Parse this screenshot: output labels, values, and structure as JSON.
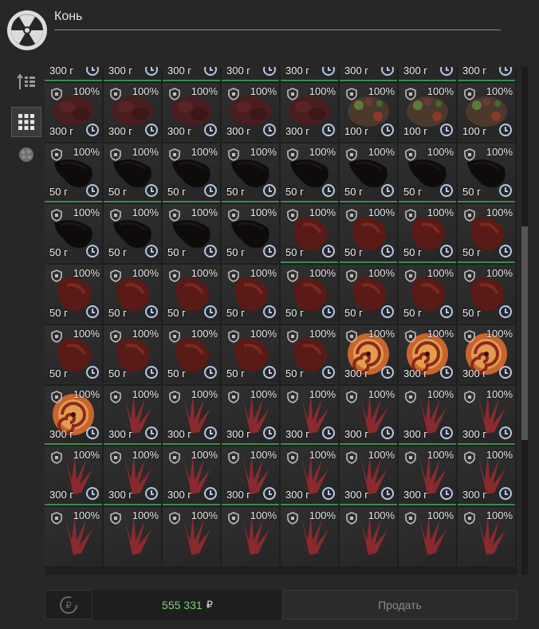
{
  "header": {
    "title": "Конь"
  },
  "sidebar": {
    "buttons": [
      {
        "name": "sort-icon"
      },
      {
        "name": "grid-view-icon",
        "active": true
      },
      {
        "name": "category-icon"
      }
    ]
  },
  "inventory": {
    "condition_icon": "shield-icon",
    "timer_icon": "clock-icon",
    "rows": [
      {
        "items": [
          {
            "pct": "",
            "wt": "300 г",
            "art": "meat",
            "green": true
          },
          {
            "pct": "",
            "wt": "300 г",
            "art": "meat",
            "green": true
          },
          {
            "pct": "",
            "wt": "300 г",
            "art": "meat",
            "green": true
          },
          {
            "pct": "",
            "wt": "300 г",
            "art": "meat",
            "green": true
          },
          {
            "pct": "",
            "wt": "300 г",
            "art": "meat",
            "green": true
          },
          {
            "pct": "",
            "wt": "300 г",
            "art": "meat",
            "green": true
          },
          {
            "pct": "",
            "wt": "300 г",
            "art": "meat",
            "green": true
          },
          {
            "pct": "",
            "wt": "300 г",
            "art": "meat",
            "green": true
          }
        ]
      },
      {
        "items": [
          {
            "pct": "100%",
            "wt": "300 г",
            "art": "meat",
            "green": false
          },
          {
            "pct": "100%",
            "wt": "300 г",
            "art": "meat",
            "green": false
          },
          {
            "pct": "100%",
            "wt": "300 г",
            "art": "meat",
            "green": false
          },
          {
            "pct": "100%",
            "wt": "300 г",
            "art": "meat",
            "green": false
          },
          {
            "pct": "100%",
            "wt": "300 г",
            "art": "meat",
            "green": false
          },
          {
            "pct": "100%",
            "wt": "100 г",
            "art": "mix",
            "green": false
          },
          {
            "pct": "100%",
            "wt": "100 г",
            "art": "mix",
            "green": false
          },
          {
            "pct": "100%",
            "wt": "100 г",
            "art": "mix",
            "green": false
          }
        ]
      },
      {
        "items": [
          {
            "pct": "100%",
            "wt": "50 г",
            "art": "liver",
            "green": true
          },
          {
            "pct": "100%",
            "wt": "50 г",
            "art": "liver",
            "green": true
          },
          {
            "pct": "100%",
            "wt": "50 г",
            "art": "liver",
            "green": true
          },
          {
            "pct": "100%",
            "wt": "50 г",
            "art": "liver",
            "green": true
          },
          {
            "pct": "100%",
            "wt": "50 г",
            "art": "liver",
            "green": true
          },
          {
            "pct": "100%",
            "wt": "50 г",
            "art": "liver",
            "green": true
          },
          {
            "pct": "100%",
            "wt": "50 г",
            "art": "liver",
            "green": true
          },
          {
            "pct": "100%",
            "wt": "50 г",
            "art": "liver",
            "green": true
          }
        ]
      },
      {
        "items": [
          {
            "pct": "100%",
            "wt": "50 г",
            "art": "liver",
            "green": false
          },
          {
            "pct": "100%",
            "wt": "50 г",
            "art": "liver",
            "green": false
          },
          {
            "pct": "100%",
            "wt": "50 г",
            "art": "liver",
            "green": false
          },
          {
            "pct": "100%",
            "wt": "50 г",
            "art": "liver",
            "green": false
          },
          {
            "pct": "100%",
            "wt": "50 г",
            "art": "heart",
            "green": true
          },
          {
            "pct": "100%",
            "wt": "50 г",
            "art": "heart",
            "green": true
          },
          {
            "pct": "100%",
            "wt": "50 г",
            "art": "heart",
            "green": true
          },
          {
            "pct": "100%",
            "wt": "50 г",
            "art": "heart",
            "green": true
          }
        ]
      },
      {
        "items": [
          {
            "pct": "100%",
            "wt": "50 г",
            "art": "heart",
            "green": false
          },
          {
            "pct": "100%",
            "wt": "50 г",
            "art": "heart",
            "green": false
          },
          {
            "pct": "100%",
            "wt": "50 г",
            "art": "heart",
            "green": false
          },
          {
            "pct": "100%",
            "wt": "50 г",
            "art": "heart",
            "green": false
          },
          {
            "pct": "100%",
            "wt": "50 г",
            "art": "heart",
            "green": false
          },
          {
            "pct": "100%",
            "wt": "50 г",
            "art": "heart",
            "green": false
          },
          {
            "pct": "100%",
            "wt": "50 г",
            "art": "heart",
            "green": false
          },
          {
            "pct": "100%",
            "wt": "50 г",
            "art": "heart",
            "green": false
          }
        ]
      },
      {
        "items": [
          {
            "pct": "100%",
            "wt": "50 г",
            "art": "heart",
            "green": false
          },
          {
            "pct": "100%",
            "wt": "50 г",
            "art": "heart",
            "green": false
          },
          {
            "pct": "100%",
            "wt": "50 г",
            "art": "heart",
            "green": false
          },
          {
            "pct": "100%",
            "wt": "50 г",
            "art": "heart",
            "green": false
          },
          {
            "pct": "100%",
            "wt": "50 г",
            "art": "heart",
            "green": false
          },
          {
            "pct": "100%",
            "wt": "300 г",
            "art": "swirl",
            "green": false
          },
          {
            "pct": "100%",
            "wt": "300 г",
            "art": "swirl",
            "green": false
          },
          {
            "pct": "100%",
            "wt": "300 г",
            "art": "swirl",
            "green": false
          }
        ]
      },
      {
        "items": [
          {
            "pct": "100%",
            "wt": "300 г",
            "art": "swirl",
            "green": true
          },
          {
            "pct": "100%",
            "wt": "300 г",
            "art": "crystal",
            "green": true
          },
          {
            "pct": "100%",
            "wt": "300 г",
            "art": "crystal",
            "green": true
          },
          {
            "pct": "100%",
            "wt": "300 г",
            "art": "crystal",
            "green": true
          },
          {
            "pct": "100%",
            "wt": "300 г",
            "art": "crystal",
            "green": true
          },
          {
            "pct": "100%",
            "wt": "300 г",
            "art": "crystal",
            "green": true
          },
          {
            "pct": "100%",
            "wt": "300 г",
            "art": "crystal",
            "green": true
          },
          {
            "pct": "100%",
            "wt": "300 г",
            "art": "crystal",
            "green": true
          }
        ]
      },
      {
        "items": [
          {
            "pct": "100%",
            "wt": "300 г",
            "art": "crystal",
            "green": true
          },
          {
            "pct": "100%",
            "wt": "300 г",
            "art": "crystal",
            "green": true
          },
          {
            "pct": "100%",
            "wt": "300 г",
            "art": "crystal",
            "green": true
          },
          {
            "pct": "100%",
            "wt": "300 г",
            "art": "crystal",
            "green": true
          },
          {
            "pct": "100%",
            "wt": "300 г",
            "art": "crystal",
            "green": true
          },
          {
            "pct": "100%",
            "wt": "300 г",
            "art": "crystal",
            "green": true
          },
          {
            "pct": "100%",
            "wt": "300 г",
            "art": "crystal",
            "green": true
          },
          {
            "pct": "100%",
            "wt": "300 г",
            "art": "crystal",
            "green": true
          }
        ]
      },
      {
        "items": [
          {
            "pct": "100%",
            "wt": "",
            "art": "crystal",
            "green": false
          },
          {
            "pct": "100%",
            "wt": "",
            "art": "crystal",
            "green": false
          },
          {
            "pct": "100%",
            "wt": "",
            "art": "crystal",
            "green": false
          },
          {
            "pct": "100%",
            "wt": "",
            "art": "crystal",
            "green": false
          },
          {
            "pct": "100%",
            "wt": "",
            "art": "crystal",
            "green": false
          },
          {
            "pct": "100%",
            "wt": "",
            "art": "crystal",
            "green": false
          },
          {
            "pct": "100%",
            "wt": "",
            "art": "crystal",
            "green": false
          },
          {
            "pct": "100%",
            "wt": "",
            "art": "crystal",
            "green": false
          }
        ]
      }
    ]
  },
  "footer": {
    "refresh_icon": "ruble-refresh-icon",
    "balance": "555 331",
    "currency": "₽",
    "sell_label": "Продать"
  },
  "colors": {
    "balance": "#7fd07f",
    "item_ready_border": "#3e8a4e",
    "timer_icon": "#b7c7e8"
  }
}
